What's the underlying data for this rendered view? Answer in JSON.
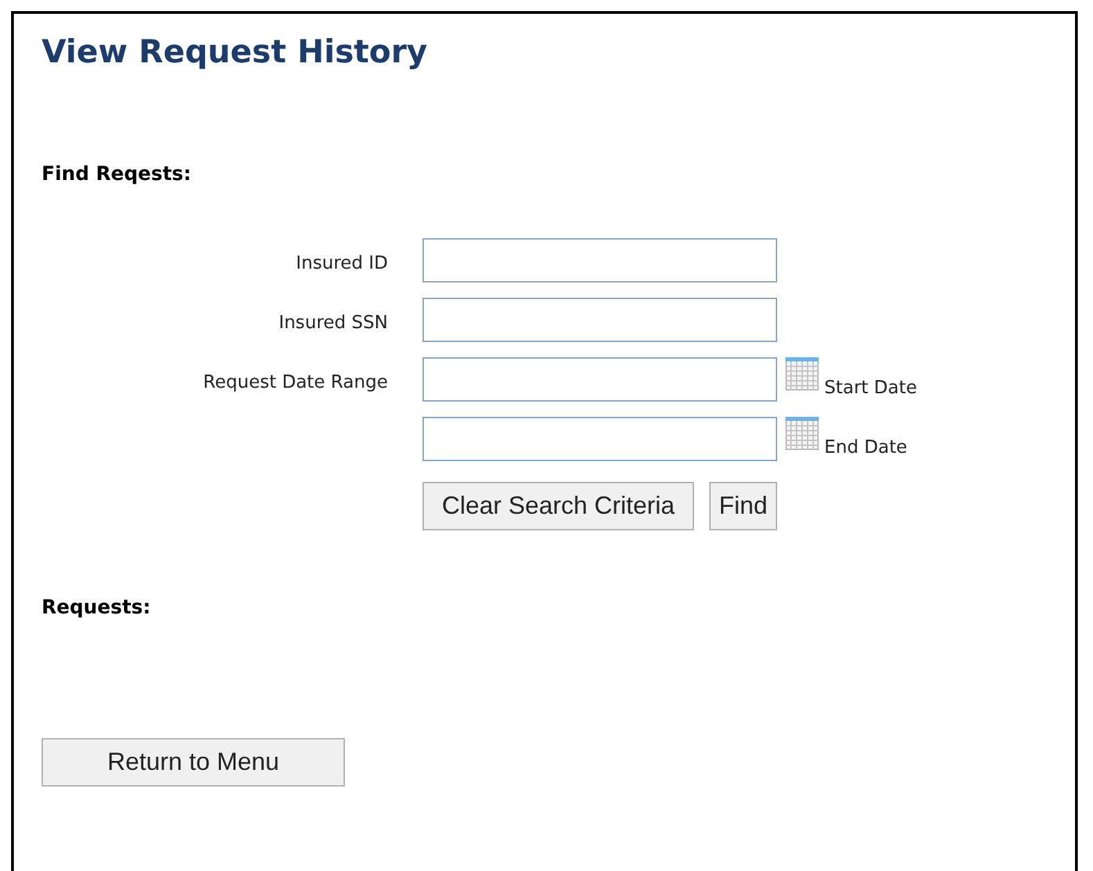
{
  "title": "View Request History",
  "find_heading": "Find Reqests:",
  "fields": [
    {
      "kind": "text",
      "label": "Insured ID"
    },
    {
      "kind": "text",
      "label": "Insured SSN"
    },
    {
      "kind": "date",
      "label": "Request Date Range",
      "suffix": "Start Date"
    },
    {
      "kind": "date",
      "suffix": "End Date"
    }
  ],
  "form_buttons": [
    "Clear Search Criteria",
    "Find"
  ],
  "requests_heading": "Requests:",
  "return_button": "Return to Menu"
}
